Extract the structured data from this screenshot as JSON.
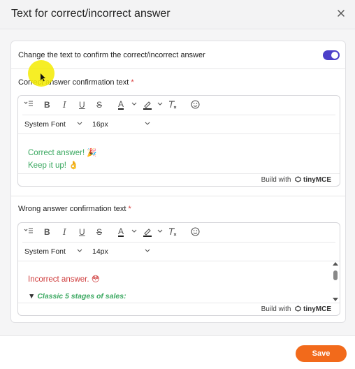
{
  "dialog": {
    "title": "Text for correct/incorrect answer",
    "close_icon": "close-icon"
  },
  "toggle_row": {
    "label": "Change the text to confirm the correct/incorrect answer",
    "enabled": true,
    "accent": "#4c3fc9"
  },
  "correct_section": {
    "label": "Correct answer confirmation text",
    "required_mark": "*",
    "font_family": "System Font",
    "font_size": "16px",
    "content_lines": [
      "Correct answer! 🎉",
      "Keep it up! 👌"
    ],
    "text_color": "#3aa860"
  },
  "wrong_section": {
    "label": "Wrong answer confirmation text",
    "required_mark": "*",
    "font_family": "System Font",
    "font_size": "14px",
    "content_line1": "Incorrect answer. 😳",
    "collapsible_marker": "▼",
    "collapsible_title": "Classic 5 stages of sales:",
    "text_color": "#cf3c3c"
  },
  "toolbar_icons": [
    "block-format-icon",
    "bold-icon",
    "italic-icon",
    "underline-icon",
    "strikethrough-icon",
    "text-color-icon",
    "highlight-icon",
    "clear-format-icon",
    "emoji-icon"
  ],
  "branding": {
    "prefix": "Build with",
    "brand": "tinyMCE"
  },
  "footer": {
    "save_label": "Save",
    "save_color": "#f26a1b"
  }
}
